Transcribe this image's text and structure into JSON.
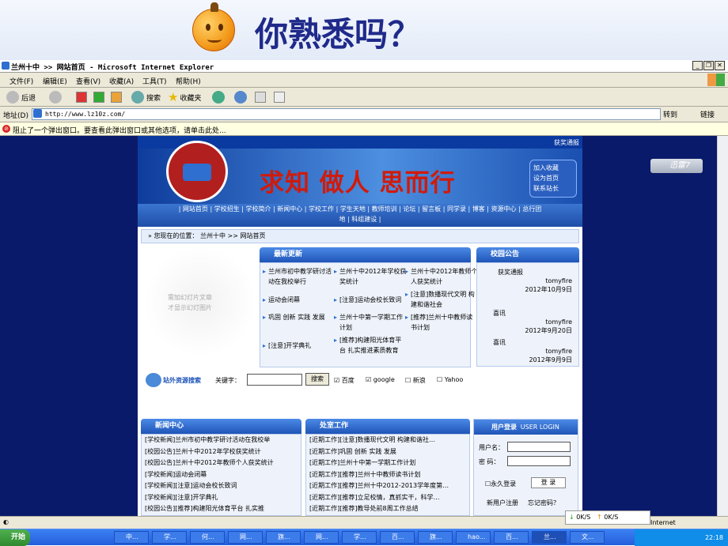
{
  "slide": {
    "title": "你熟悉吗？"
  },
  "window": {
    "title": "兰州十中 >> 网站首页 - Microsoft Internet Explorer"
  },
  "menu": [
    "文件(F)",
    "编辑(E)",
    "查看(V)",
    "收藏(A)",
    "工具(T)",
    "帮助(H)"
  ],
  "toolbar": {
    "back": "后退",
    "search": "搜索",
    "favorites": "收藏夹"
  },
  "address": {
    "label": "地址(D)",
    "url": "http://www.lz10z.com/",
    "go": "转到",
    "links": "链接"
  },
  "infobar": "阻止了一个弹出窗口。要查看此弹出窗口或其他选项，请单击此处...",
  "site": {
    "top_link": "获奖通报",
    "motto": "求知  做人  思而行",
    "quick_links": [
      "加入收藏",
      "设为首页",
      "联系站长"
    ],
    "nav_line1": "| 网站首页 | 学校招生 | 学校简介 | 新闻中心 | 学校工作 | 学生天地 | 教师培训 | 论坛 | 留言板 | 同学录 | 博客 | 资源中心 | 总行团",
    "nav_line2": "地 | 科组建设 |",
    "breadcrumb": "»  您现在的位置： 兰州十中 >> 网站首页",
    "slideshow_text": [
      "需加幻灯片文章",
      "才显示幻灯图片"
    ],
    "latest": {
      "title": "最新更新",
      "items": [
        "兰州市初中教学研讨活动在我校举行",
        "兰州十中2012年学校获奖统计",
        "兰州十中2012年教师个人获奖统计",
        "运动会闭幕",
        "[注意]运动会校长致词",
        "[注意]数播现代文明  构建和谐社会",
        "巩固  创新  实践  发展",
        "兰州十中第一学期工作计划",
        "[推荐]兰州十中教师读书计划",
        "[注意]开学典礼",
        "[推荐]构建阳光体育平台  扎实推进素质教育"
      ]
    },
    "notice": {
      "title": "校园公告",
      "items": [
        {
          "title": "获奖通报",
          "author": "tomyfire",
          "date": "2012年10月9日"
        },
        {
          "title": "喜讯",
          "author": "tomyfire",
          "date": "2012年9月20日"
        },
        {
          "title": "喜讯",
          "author": "tomyfire",
          "date": "2012年9月9日"
        }
      ]
    },
    "search": {
      "label": "站外资源搜索",
      "keyword": "关键字：",
      "button": "搜索",
      "engines": [
        "百度",
        "google",
        "新浪",
        "Yahoo"
      ]
    },
    "news": {
      "title": "新闻中心",
      "items": [
        "[学校新闻]兰州市初中教学研讨活动在我校举",
        "[校园公告]兰州十中2012年学校获奖统计",
        "[校园公告]兰州十中2012年教师个人获奖统计",
        "[学校新闻]运动会闭幕",
        "[学校新闻][注意]运动会校长致词",
        "[学校新闻][注意]开学典礼",
        "[校园公告][推荐]构建阳光体育平台   扎实推"
      ]
    },
    "work": {
      "title": "处室工作",
      "items": [
        "[近期工作][注意]数播现代文明   构建和谐社…",
        "[近期工作]巩固  创新  实践  发展",
        "[近期工作]兰州十中第一学期工作计划",
        "[近期工作][推荐]兰州十中教师读书计划",
        "[近期工作][推荐]兰州十中2012-2013学年度第…",
        "[近期工作][推荐]立足校情，真抓实干，科学…",
        "[近期工作][推荐]教导处前8周工作总结"
      ]
    },
    "login": {
      "title": "用户登录",
      "title_en": "USER LOGIN",
      "user": "用户名：",
      "pass": "密  码：",
      "remember": "永久登录",
      "button": "登 录",
      "register": "新用户注册",
      "forgot": "忘记密码？"
    }
  },
  "xunlei": "迅雷7",
  "speed": {
    "down": "0K/S",
    "up": "0K/S"
  },
  "status_right": "Internet",
  "taskbar": {
    "start": "开始",
    "tasks": [
      "中...",
      "学...",
      "何...",
      "网...",
      "旗...",
      "网...",
      "学...",
      "百...",
      "旗...",
      "hao...",
      "百...",
      "兰...",
      "文..."
    ],
    "clock": "22:18"
  }
}
